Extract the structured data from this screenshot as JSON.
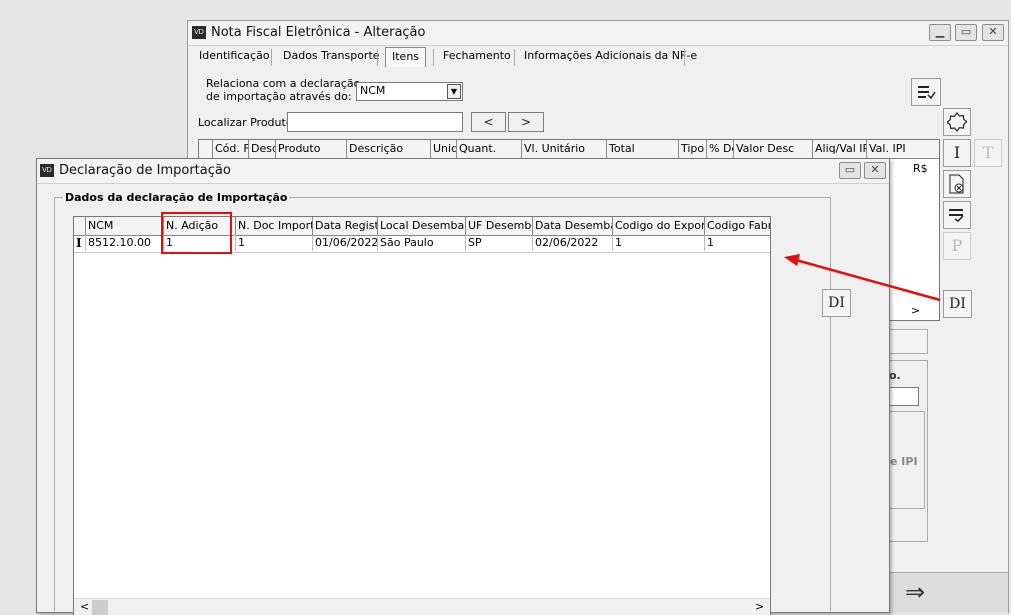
{
  "main_window": {
    "logo": "VD",
    "title": "Nota Fiscal Eletrônica - Alteração",
    "tabs": [
      {
        "label": "Identificação",
        "active": false
      },
      {
        "label": "Dados Transporte",
        "active": false
      },
      {
        "label": "Itens",
        "active": true
      },
      {
        "label": "Fechamento",
        "active": false
      },
      {
        "label": "Informações Adicionais da NF-e",
        "active": false
      }
    ],
    "relaciona_label_line1": "Relaciona com a declaração",
    "relaciona_label_line2": "de importação através do:",
    "relaciona_select_value": "NCM",
    "localizar_label": "Localizar Produto",
    "localizar_value": "",
    "prev_label": "<",
    "next_label": ">",
    "grid_headers": [
      "Cód. F",
      "Desd",
      "Produto",
      "Descrição",
      "Unid",
      "Quant.",
      "Vl. Unitário",
      "Total",
      "Tipo",
      "% De",
      "Valor Desc",
      "Aliq/Val IP",
      "Val. IPI"
    ],
    "grid_partial_value": "R$",
    "partial_label_a": "o.",
    "partial_label_b": "e IPI",
    "side_icons": {
      "top": "list-check-icon",
      "star": "badge-icon",
      "i_label": "I",
      "t_label": "T",
      "doc": "document-remove-icon",
      "list": "list-edit-icon",
      "p_label": "P",
      "di_label": "DI"
    },
    "arrow_symbol": "⇒"
  },
  "dialog": {
    "logo": "VD",
    "title": "Declaração de Importação",
    "group_title": "Dados da declaração de Importação",
    "columns": [
      "NCM",
      "N. Adição",
      "N. Doc Importaçã",
      "Data Registro",
      "Local Desembaraço",
      "UF Desembaraço",
      "Data Desembaraço",
      "Codigo do Exportador",
      "Codigo Fabricante"
    ],
    "rows": [
      {
        "indicator": "I",
        "cells": [
          "8512.10.00",
          "1",
          "1",
          "01/06/2022",
          "São Paulo",
          "SP",
          "02/06/2022",
          "1",
          "1"
        ]
      }
    ],
    "di_label": "DI",
    "scroll_left": "<",
    "scroll_right": ">"
  },
  "colors": {
    "highlight_red": "#e01010",
    "titlebar_bg": "#f3f3f3",
    "window_bg": "#f0f0f0"
  }
}
